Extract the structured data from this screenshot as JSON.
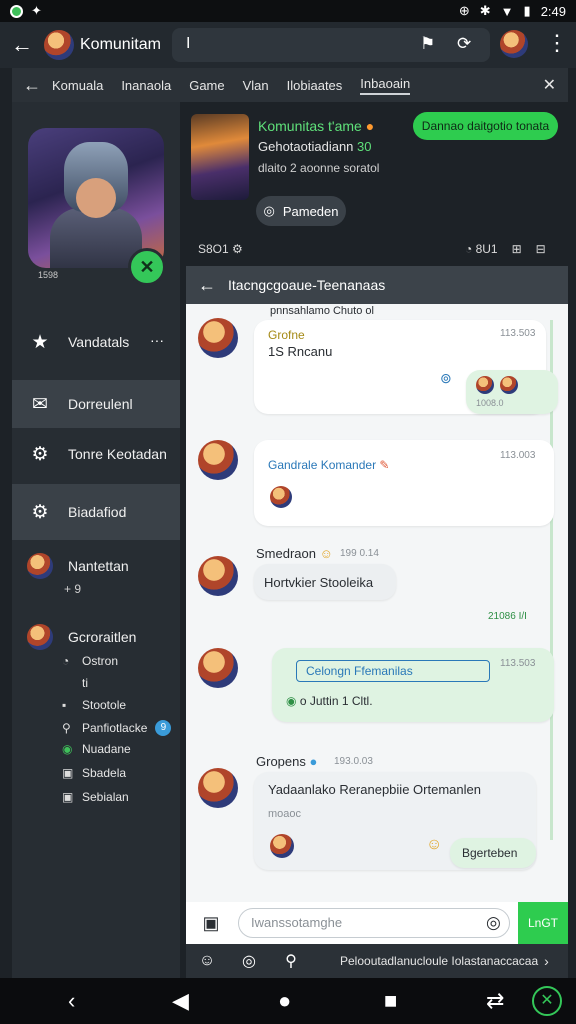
{
  "status_bar": {
    "time": "2:49"
  },
  "app_bar": {
    "title": "Komunitam",
    "search_value": "I"
  },
  "tabs": {
    "items": [
      "Komuala",
      "Inanaola",
      "Game",
      "Vlan",
      "Ilobiaates",
      "Inbaoain"
    ],
    "active_index": 5
  },
  "sidebar": {
    "hero_caption": "1598",
    "items": [
      {
        "label": "Vandatals",
        "icon": "star-icon"
      },
      {
        "label": "Dorreulenl",
        "icon": "inbox-icon"
      },
      {
        "label": "Tonre Keotadan",
        "icon": "gear-icon"
      },
      {
        "label": "Biadafiod",
        "icon": "gear-icon"
      },
      {
        "label": "Nantettan",
        "icon": "avatar"
      },
      {
        "label": "Gcroraitlen",
        "icon": "avatar"
      }
    ],
    "nantettan_meta": "+ 9",
    "more_label": "···",
    "sub_items": [
      {
        "label": "Ostron",
        "icon": "people-icon"
      },
      {
        "label": "ti",
        "icon": ""
      },
      {
        "label": "Stootole",
        "icon": "square-icon"
      },
      {
        "label": "Panfiotlacke",
        "icon": "pin-icon",
        "badge": "9"
      },
      {
        "label": "Nuadane",
        "icon": "people-icon"
      },
      {
        "label": "Sbadela",
        "icon": "square-icon"
      },
      {
        "label": "Sebialan",
        "icon": "square-icon"
      }
    ]
  },
  "community": {
    "title": "Komunitas t'ame",
    "subtitle": "Gehotaotiadiann",
    "subtitle_badge": "30",
    "meta": "dlaito 2 aoonne soratol",
    "join_label": "Dannao daitgotio tonata",
    "pill_label": "Pameden",
    "stat_left": "S8O1",
    "stat_right": [
      "8U1",
      "⊞",
      "⊟"
    ]
  },
  "chat": {
    "header_title": "Itacngcgoaue-Teenanaas",
    "header_sub": "pnnsahlamo Chuto ol",
    "messages": [
      {
        "name": "Grofne",
        "text": "1S Rncanu",
        "time": "113.503",
        "reply_time": "1008.0"
      },
      {
        "name": "Gandrale Komander",
        "text": "",
        "time": "113.003"
      },
      {
        "name": "Smedraon",
        "text": "Hortvkier Stooleika",
        "time": "199 0.14",
        "reply_time": "21086 I/I"
      },
      {
        "name": "Celongn Ffemanilas",
        "text": "o Juttin 1 Cltl.",
        "time": "113.503"
      },
      {
        "name": "Gropens",
        "text": "Yadaanlako Reranepbiie Ortemanlen",
        "meta": "moaoc",
        "time": "193.0.03",
        "reply_label": "Bgerteben"
      }
    ],
    "composer_placeholder": "Iwanssotamghe",
    "send_label": "LnGT",
    "bottom_text": "Pelooutadlanucloule Iolastanaccacaa"
  }
}
